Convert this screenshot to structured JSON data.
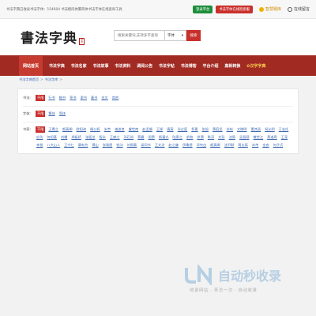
{
  "topbar": {
    "notice": "书法字典已收录书法字体：154604 书法楷码体繁简体书法字体在线查询工具",
    "btn_platform": "登录平台",
    "btn_font": "书法字体在线检索服",
    "link_vip": "智慧题库",
    "link_message": "在线留言"
  },
  "logo": {
    "text": "書法字典",
    "seal": "书法"
  },
  "search": {
    "placeholder": "搜索关键词,支持多字查询",
    "select_value": "字体",
    "button": "搜索"
  },
  "nav": {
    "items": [
      {
        "label": "网站首页",
        "active": true
      },
      {
        "label": "书法字典"
      },
      {
        "label": "书法名家"
      },
      {
        "label": "书法故事"
      },
      {
        "label": "书法资料"
      },
      {
        "label": "调阅公告"
      },
      {
        "label": "书法字帖"
      },
      {
        "label": "书法博客"
      },
      {
        "label": "平台介绍"
      },
      {
        "label": "高新转换"
      },
      {
        "label": "汉字字典",
        "special": true
      }
    ]
  },
  "breadcrumb": {
    "home": "书法字典首页",
    "sep": ">",
    "current": "书法字库",
    "tail": ">"
  },
  "filters": {
    "font_label": "书法:",
    "font_options": [
      "不限",
      "行书",
      "楷书",
      "草书",
      "隶书",
      "篆书",
      "金文",
      "其他"
    ],
    "mode_label": "字体:",
    "mode_options": [
      "不限",
      "繁体",
      "简体"
    ],
    "author_label": "书家:",
    "author_options": [
      "不限",
      "王羲之",
      "颜真卿",
      "欧阳询",
      "柳公权",
      "米芾",
      "褚遂良",
      "虞世南",
      "赵孟頫",
      "王铎",
      "唐寅",
      "孙过庭",
      "怀素",
      "张旭",
      "黄庭坚",
      "苏轼",
      "文徵明",
      "董其昌",
      "祝允明",
      "于右任",
      "启功",
      "何绍基",
      "刘墉",
      "郑板桥",
      "张猛龙",
      "智永",
      "王献之",
      "邓石如",
      "蔡襄",
      "倪瓒",
      "杨凝式",
      "陆柬之",
      "俞和",
      "徐渭",
      "陈淳",
      "文彭",
      "沈周",
      "吴昌硕",
      "敬世江",
      "黄道周",
      "王宠",
      "李邕",
      "八大山人",
      "王守仁",
      "康有为",
      "傅山",
      "张瑞图",
      "钱沣",
      "刘熙载",
      "梁同书",
      "王文治",
      "赵之谦",
      "伊秉绶",
      "邓完白",
      "颜真卿",
      "沈尹默",
      "周志高",
      "米芾",
      "金农",
      "何子贞"
    ]
  },
  "watermark": {
    "title": "自动秒收录",
    "subtitle": "收录网站 · 来访一次 · 自动收录"
  }
}
